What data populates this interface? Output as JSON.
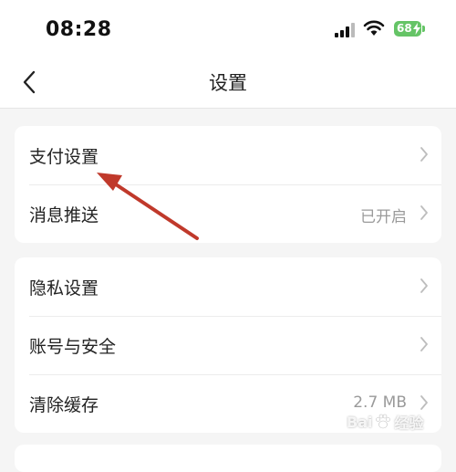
{
  "status_bar": {
    "time": "08:28",
    "battery_level": "68",
    "battery_color": "#65c466"
  },
  "nav": {
    "title": "设置",
    "back_icon": "chevron-left-icon"
  },
  "groups": [
    {
      "items": [
        {
          "label": "支付设置",
          "value": ""
        },
        {
          "label": "消息推送",
          "value": "已开启"
        }
      ]
    },
    {
      "items": [
        {
          "label": "隐私设置",
          "value": ""
        },
        {
          "label": "账号与安全",
          "value": ""
        },
        {
          "label": "清除缓存",
          "value": "2.7 MB"
        }
      ]
    }
  ],
  "annotation": {
    "arrow_color": "#c0392b",
    "target": "支付设置"
  },
  "watermark": {
    "left_text": "Bai",
    "right_text": "经验"
  }
}
